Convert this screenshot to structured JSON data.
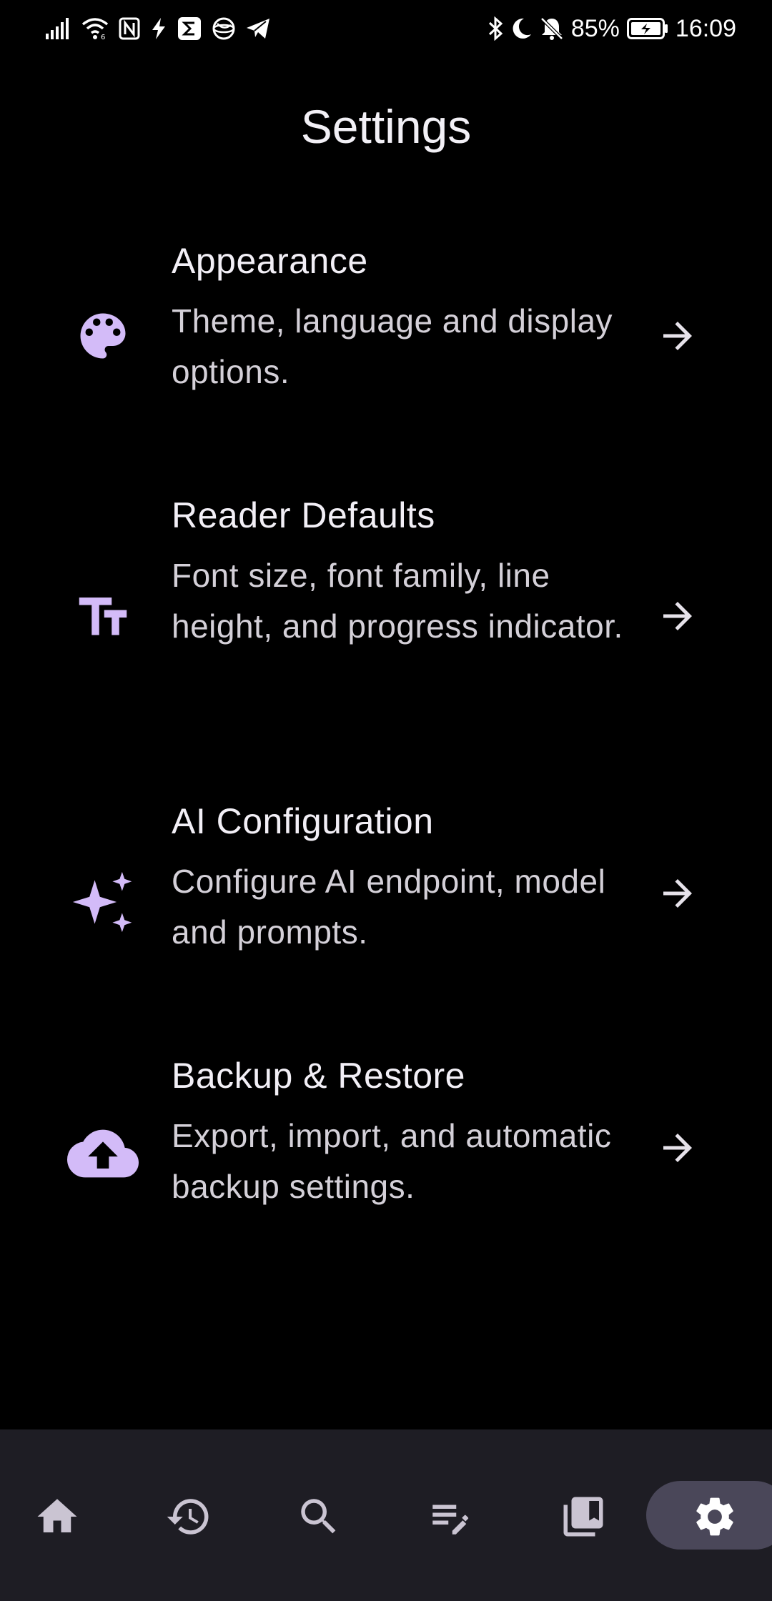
{
  "status_bar": {
    "battery_percent": "85%",
    "time": "16:09",
    "left_icons": [
      "signal-icon",
      "wifi-icon",
      "nfc-icon",
      "flash-icon",
      "sigma-app-icon",
      "globe-app-icon",
      "telegram-icon"
    ],
    "right_icons": [
      "bluetooth-icon",
      "do-not-disturb-moon-icon",
      "muted-bell-icon",
      "battery-charging-icon"
    ]
  },
  "header": {
    "title": "Settings"
  },
  "settings": {
    "items": [
      {
        "icon": "palette-icon",
        "title": "Appearance",
        "description": "Theme, language and display options."
      },
      {
        "icon": "text-size-icon",
        "title": "Reader Defaults",
        "description": "Font size, font family, line height, and progress indicator."
      },
      {
        "icon": "sparkles-icon",
        "title": "AI Configuration",
        "description": "Configure AI endpoint, model and prompts."
      },
      {
        "icon": "cloud-upload-icon",
        "title": "Backup & Restore",
        "description": "Export, import, and automatic backup settings."
      }
    ]
  },
  "bottom_nav": {
    "items": [
      "home-icon",
      "history-icon",
      "search-icon",
      "notes-edit-icon",
      "library-icon",
      "settings-gear-icon"
    ],
    "active": "settings-gear-icon"
  },
  "colors": {
    "background": "#000000",
    "accent": "#d3bbf8",
    "nav_background": "#1e1d24",
    "nav_active": "#4a4759"
  }
}
